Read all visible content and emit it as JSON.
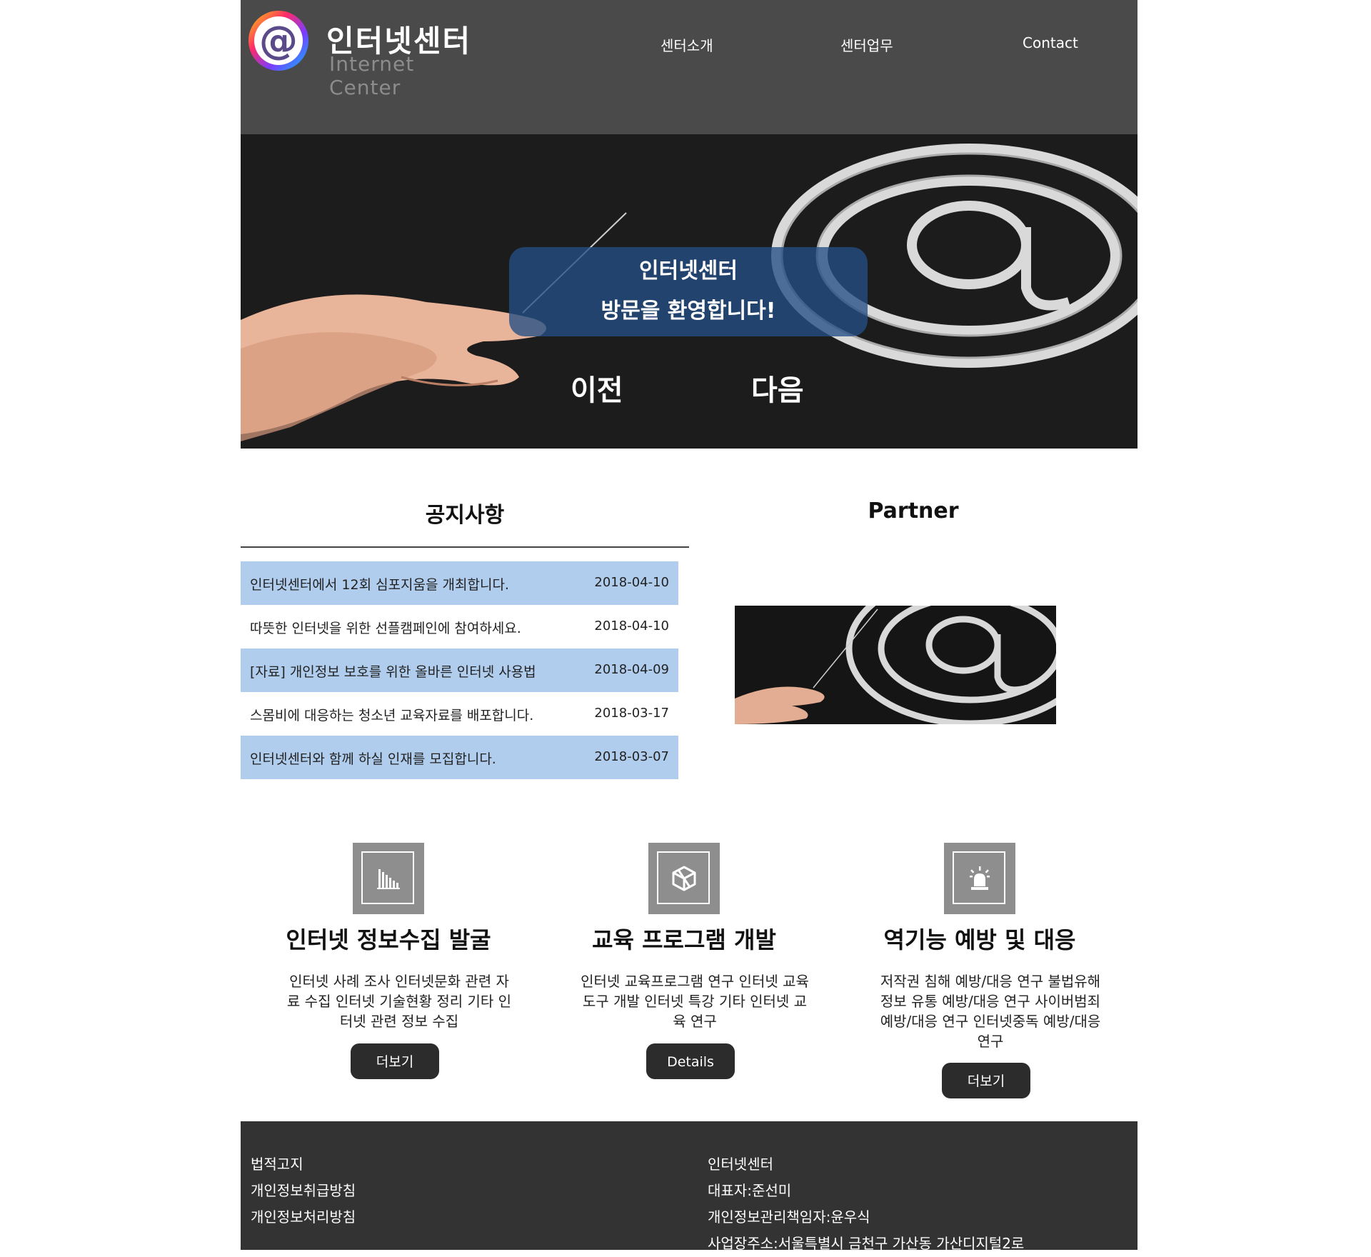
{
  "header": {
    "logo": {
      "title": "인터넷센터",
      "subtitle": "Internet Center",
      "mark": "at-sign-logo"
    },
    "nav": [
      "센터소개",
      "센터업무",
      "Contact"
    ]
  },
  "hero": {
    "line1": "인터넷센터",
    "line2": "방문을 환영합니다!",
    "prev_label": "이전",
    "next_label": "다음",
    "overlay_color": "#224e84"
  },
  "notice": {
    "title": "공지사항",
    "items": [
      {
        "text": "인터넷센터에서 12회 심포지움을 개최합니다.",
        "date": "2018-04-10"
      },
      {
        "text": "따뜻한 인터넷을 위한 선플캠페인에 참여하세요.",
        "date": "2018-04-10"
      },
      {
        "text": "[자료] 개인정보 보호를 위한 올바른 인터넷 사용법",
        "date": "2018-04-09"
      },
      {
        "text": "스몸비에 대응하는 청소년 교육자료를 배포합니다.",
        "date": "2018-03-17"
      },
      {
        "text": "인터넷센터와 함께 하실 인재를 모집합니다.",
        "date": "2018-03-07"
      }
    ],
    "row_highlight_color": "#b0cdee"
  },
  "partner": {
    "title": "Partner"
  },
  "features": [
    {
      "icon": "bar-chart-icon",
      "title": "인터넷 정보수집 발굴",
      "desc": "인터넷 사례 조사 인터넷문화 관련 자료 수집 인터넷 기술현황 정리 기타 인터넷 관련 정보 수집",
      "button": "더보기"
    },
    {
      "icon": "cube-icon",
      "title": "교육 프로그램 개발",
      "desc": "인터넷 교육프로그램 연구 인터넷 교육도구 개발 인터넷 특강 기타 인터넷 교육 연구",
      "button": "Details"
    },
    {
      "icon": "alarm-light-icon",
      "title": "역기능 예방 및 대응",
      "desc": "저작권 침해 예방/대응 연구 불법유해정보 유통 예방/대응 연구 사이버범죄 예방/대응 연구 인터넷중독 예방/대응 연구",
      "button": "더보기"
    }
  ],
  "footer": {
    "links": [
      "법적고지",
      "개인정보취급방침",
      "개인정보처리방침"
    ],
    "info": [
      "인터넷센터",
      "대표자:준선미",
      "개인정보관리책임자:윤우식",
      "사업장주소:서울특별시 금천구 가산동 가산디지털2로"
    ]
  },
  "colors": {
    "header_bg": "#4a4a4a",
    "footer_bg": "#333333",
    "button_bg": "#2c2c2c",
    "icon_bg": "#8e8e8e"
  }
}
